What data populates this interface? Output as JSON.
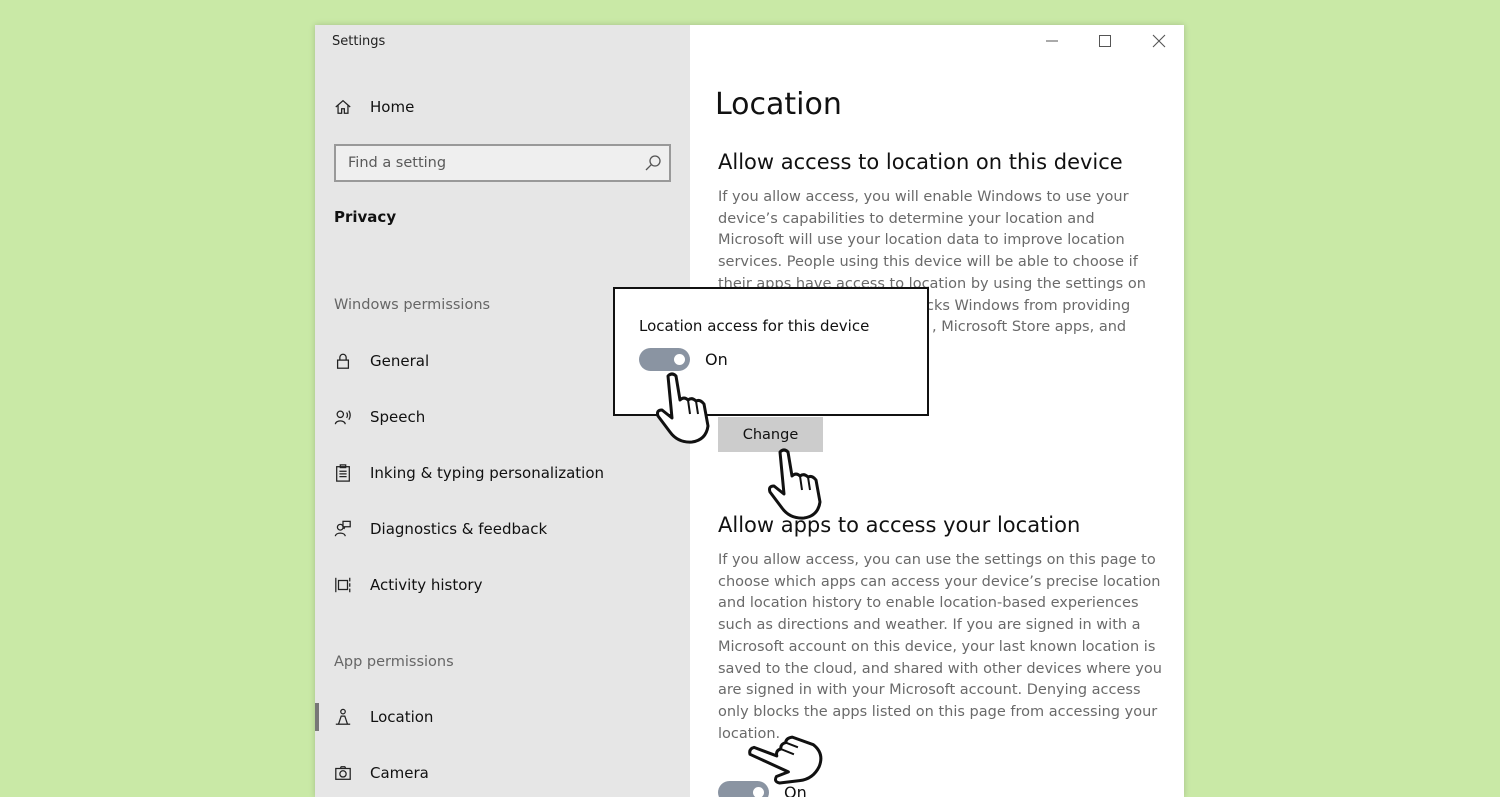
{
  "window": {
    "title": "Settings"
  },
  "sidebar": {
    "home_label": "Home",
    "search": {
      "placeholder": "Find a setting"
    },
    "category": "Privacy",
    "windows_permissions": {
      "heading": "Windows permissions",
      "items": [
        {
          "label": "General",
          "icon": "lock-icon"
        },
        {
          "label": "Speech",
          "icon": "speech-icon"
        },
        {
          "label": "Inking & typing personalization",
          "icon": "inking-icon"
        },
        {
          "label": "Diagnostics & feedback",
          "icon": "diagnostics-icon"
        },
        {
          "label": "Activity history",
          "icon": "activity-history-icon"
        }
      ]
    },
    "app_permissions": {
      "heading": "App permissions",
      "items": [
        {
          "label": "Location",
          "icon": "location-icon",
          "selected": true
        },
        {
          "label": "Camera",
          "icon": "camera-icon"
        }
      ]
    }
  },
  "main": {
    "title": "Location",
    "device_section": {
      "heading": "Allow access to location on this device",
      "lines": [
        "If you allow access, you will enable Windows to use your",
        "device’s capabilities to determine your location and",
        "Microsoft will use your location data to improve location",
        "services. People using this device will be able to choose if",
        "their apps have access to location by using the settings on",
        "",
        ""
      ],
      "hidden_fragments": [
        "cks Windows from providing",
        ", Microsoft Store apps, and"
      ],
      "change_button": "Change"
    },
    "apps_section": {
      "heading": "Allow apps to access your location",
      "lines": [
        "If you allow access, you can use the settings on this page to",
        "choose which apps can access your device’s precise location",
        "and location history to enable location-based experiences",
        "such as directions and weather. If you are signed in with a",
        "Microsoft account on this device, your last known location is",
        "saved to the cloud, and shared with other devices where you",
        "are signed in with your Microsoft account. Denying access",
        "only blocks the apps listed on this page from accessing your",
        "location."
      ],
      "toggle_label": "On",
      "toggle_on": true
    }
  },
  "popup": {
    "title": "Location access for this device",
    "toggle_label": "On",
    "toggle_on": true
  },
  "colors": {
    "background": "#c9e9a6",
    "sidebar": "#e6e6e6",
    "toggle": "#8a94a2"
  }
}
